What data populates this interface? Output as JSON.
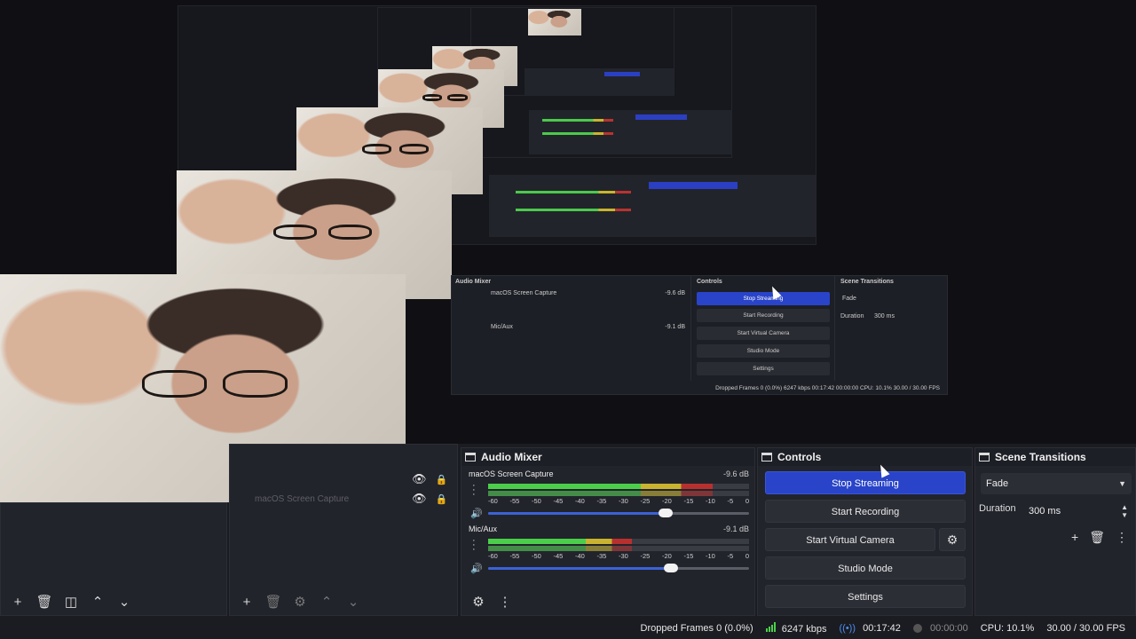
{
  "preview_nested": {
    "audio_mixer_title": "Audio Mixer",
    "controls_title": "Controls",
    "transitions_title": "Scene Transitions",
    "sources": [
      {
        "name": "macOS Screen Capture",
        "db": "-9.6 dB"
      },
      {
        "name": "Mic/Aux",
        "db": "-9.1 dB"
      }
    ],
    "buttons": [
      "Stop Streaming",
      "Start Recording",
      "Start Virtual Camera",
      "Studio Mode",
      "Settings"
    ],
    "transition": "Fade",
    "duration_label": "Duration",
    "duration_value": "300 ms",
    "status": "Dropped Frames 0 (0.0%)    6247 kbps    00:17:42    00:00:00    CPU: 10.1%    30.00 / 30.00 FPS"
  },
  "sources_dock": {
    "partial_source": "macOS Screen Capture"
  },
  "audio_mixer": {
    "title": "Audio Mixer",
    "scale": [
      "-60",
      "-55",
      "-50",
      "-45",
      "-40",
      "-35",
      "-30",
      "-25",
      "-20",
      "-15",
      "-10",
      "-5",
      "0"
    ],
    "tracks": [
      {
        "name": "macOS Screen Capture",
        "db": "-9.6 dB",
        "level": 0.86,
        "volume": 0.68
      },
      {
        "name": "Mic/Aux",
        "db": "-9.1 dB",
        "level": 0.55,
        "volume": 0.7
      }
    ]
  },
  "controls": {
    "title": "Controls",
    "stop_streaming": "Stop Streaming",
    "start_recording": "Start Recording",
    "start_virtual_camera": "Start Virtual Camera",
    "studio_mode": "Studio Mode",
    "settings": "Settings"
  },
  "transitions": {
    "title": "Scene Transitions",
    "selected": "Fade",
    "duration_label": "Duration",
    "duration_value": "300 ms"
  },
  "statusbar": {
    "dropped_frames": "Dropped Frames 0 (0.0%)",
    "bitrate": "6247 kbps",
    "stream_time": "00:17:42",
    "record_time": "00:00:00",
    "cpu": "CPU: 10.1%",
    "fps": "30.00 / 30.00 FPS"
  },
  "colors": {
    "accent": "#2944c8",
    "meter_green": "#4bcf4b",
    "meter_yellow": "#c9b32f",
    "meter_red": "#b8302e"
  }
}
